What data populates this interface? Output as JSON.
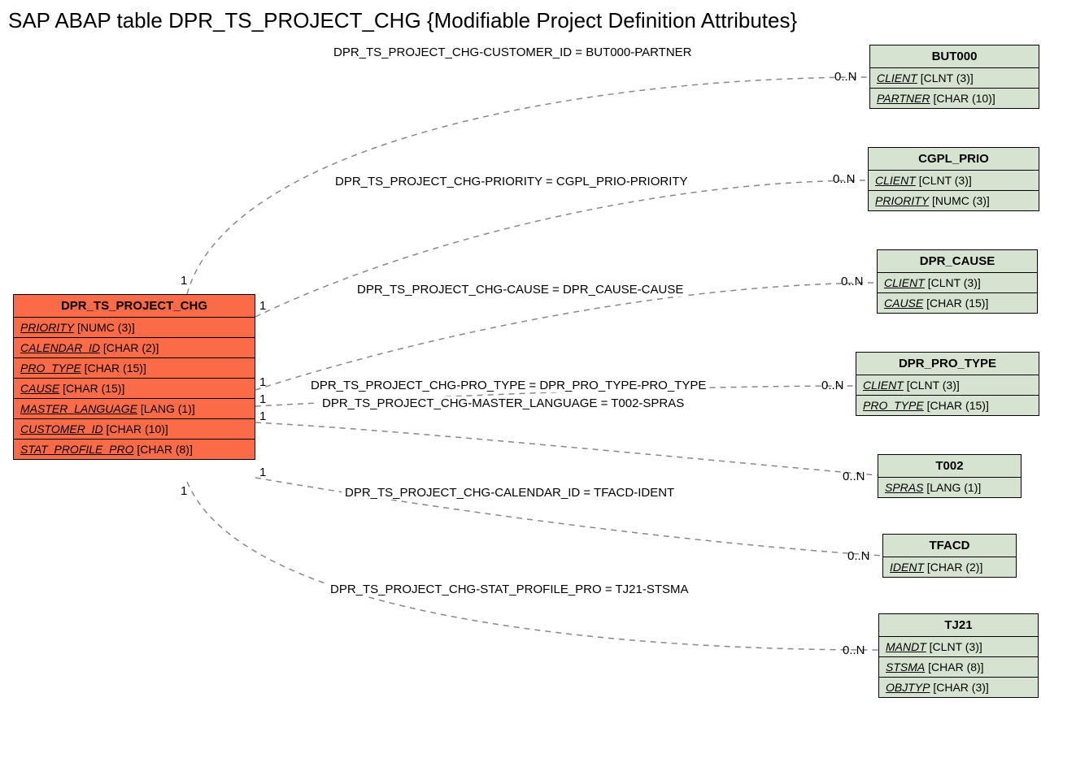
{
  "title": "SAP ABAP table DPR_TS_PROJECT_CHG {Modifiable Project Definition Attributes}",
  "mainEntity": {
    "name": "DPR_TS_PROJECT_CHG",
    "fields": [
      {
        "name": "PRIORITY",
        "type": "[NUMC (3)]"
      },
      {
        "name": "CALENDAR_ID",
        "type": "[CHAR (2)]"
      },
      {
        "name": "PRO_TYPE",
        "type": "[CHAR (15)]"
      },
      {
        "name": "CAUSE",
        "type": "[CHAR (15)]"
      },
      {
        "name": "MASTER_LANGUAGE",
        "type": "[LANG (1)]"
      },
      {
        "name": "CUSTOMER_ID",
        "type": "[CHAR (10)]"
      },
      {
        "name": "STAT_PROFILE_PRO",
        "type": "[CHAR (8)]"
      }
    ]
  },
  "refEntities": [
    {
      "name": "BUT000",
      "fields": [
        {
          "name": "CLIENT",
          "type": "[CLNT (3)]"
        },
        {
          "name": "PARTNER",
          "type": "[CHAR (10)]"
        }
      ]
    },
    {
      "name": "CGPL_PRIO",
      "fields": [
        {
          "name": "CLIENT",
          "type": "[CLNT (3)]"
        },
        {
          "name": "PRIORITY",
          "type": "[NUMC (3)]"
        }
      ]
    },
    {
      "name": "DPR_CAUSE",
      "fields": [
        {
          "name": "CLIENT",
          "type": "[CLNT (3)]"
        },
        {
          "name": "CAUSE",
          "type": "[CHAR (15)]"
        }
      ]
    },
    {
      "name": "DPR_PRO_TYPE",
      "fields": [
        {
          "name": "CLIENT",
          "type": "[CLNT (3)]"
        },
        {
          "name": "PRO_TYPE",
          "type": "[CHAR (15)]"
        }
      ]
    },
    {
      "name": "T002",
      "fields": [
        {
          "name": "SPRAS",
          "type": "[LANG (1)]"
        }
      ]
    },
    {
      "name": "TFACD",
      "fields": [
        {
          "name": "IDENT",
          "type": "[CHAR (2)]"
        }
      ]
    },
    {
      "name": "TJ21",
      "fields": [
        {
          "name": "MANDT",
          "type": "[CLNT (3)]"
        },
        {
          "name": "STSMA",
          "type": "[CHAR (8)]"
        },
        {
          "name": "OBJTYP",
          "type": "[CHAR (3)]"
        }
      ]
    }
  ],
  "relations": [
    {
      "label": "DPR_TS_PROJECT_CHG-CUSTOMER_ID = BUT000-PARTNER"
    },
    {
      "label": "DPR_TS_PROJECT_CHG-PRIORITY = CGPL_PRIO-PRIORITY"
    },
    {
      "label": "DPR_TS_PROJECT_CHG-CAUSE = DPR_CAUSE-CAUSE"
    },
    {
      "label": "DPR_TS_PROJECT_CHG-PRO_TYPE = DPR_PRO_TYPE-PRO_TYPE"
    },
    {
      "label": "DPR_TS_PROJECT_CHG-MASTER_LANGUAGE = T002-SPRAS"
    },
    {
      "label": "DPR_TS_PROJECT_CHG-CALENDAR_ID = TFACD-IDENT"
    },
    {
      "label": "DPR_TS_PROJECT_CHG-STAT_PROFILE_PRO = TJ21-STSMA"
    }
  ],
  "cardinality": {
    "left": "1",
    "right": "0..N"
  }
}
